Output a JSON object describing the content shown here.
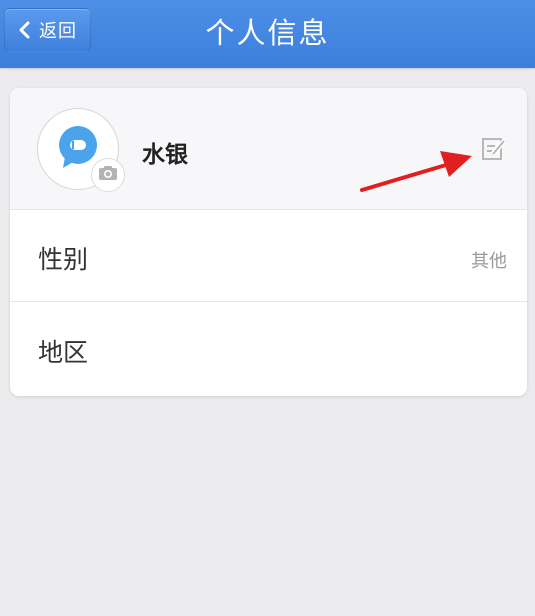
{
  "header": {
    "title": "个人信息",
    "back_label": "返回",
    "color": "#4a8be4"
  },
  "profile": {
    "nickname": "水银",
    "avatar_icon": "chat-bubble-icon",
    "avatar_color": "#4ba3ec",
    "camera_icon": "camera-icon",
    "edit_icon": "edit-icon"
  },
  "rows": [
    {
      "label": "性别",
      "value": "其他"
    },
    {
      "label": "地区",
      "value": ""
    }
  ],
  "annotation": {
    "arrow_color": "#e02020"
  }
}
